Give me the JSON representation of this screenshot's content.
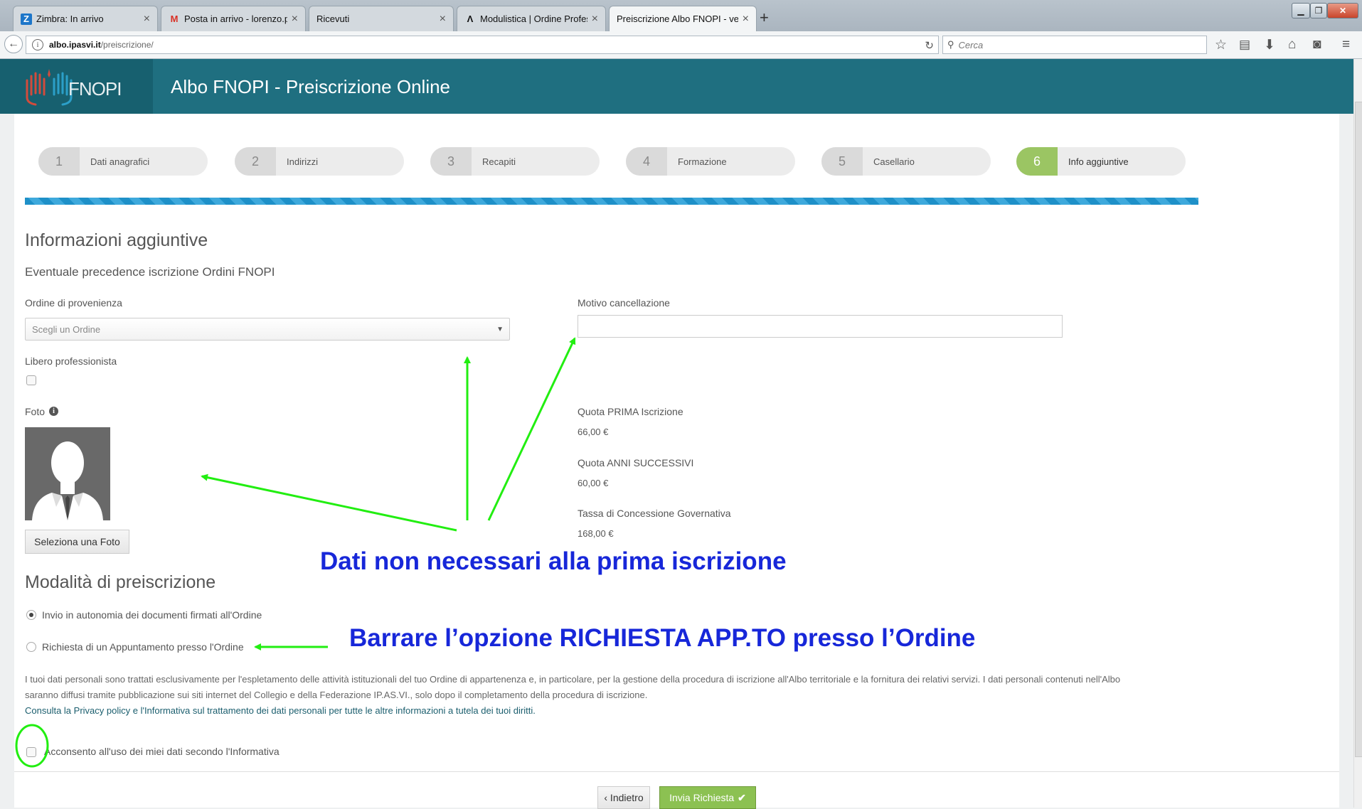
{
  "browser": {
    "tabs": [
      {
        "icon": "Z",
        "title": "Zimbra: In arrivo"
      },
      {
        "icon": "M",
        "title": "Posta in arrivo - lorenzo.pa..."
      },
      {
        "icon": "",
        "title": "Ricevuti"
      },
      {
        "icon": "Λ",
        "title": "Modulistica | Ordine Profes..."
      },
      {
        "icon": "",
        "title": "Preiscrizione Albo FNOPI - ver. ..."
      }
    ],
    "url_host": "albo.ipasvi.it",
    "url_path": "/preiscrizione/",
    "search_placeholder": "Cerca"
  },
  "header": {
    "logo_text": "FNOPI",
    "title": "Albo FNOPI - Preiscrizione Online"
  },
  "steps": [
    {
      "num": "1",
      "label": "Dati anagrafici"
    },
    {
      "num": "2",
      "label": "Indirizzi"
    },
    {
      "num": "3",
      "label": "Recapiti"
    },
    {
      "num": "4",
      "label": "Formazione"
    },
    {
      "num": "5",
      "label": "Casellario"
    },
    {
      "num": "6",
      "label": "Info aggiuntive"
    }
  ],
  "form": {
    "section_title": "Informazioni aggiuntive",
    "subsection": "Eventuale precedence iscrizione Ordini FNOPI",
    "ordine_label": "Ordine di provenienza",
    "ordine_placeholder": "Scegli un Ordine",
    "motivo_label": "Motivo cancellazione",
    "libero_label": "Libero professionista",
    "foto_label": "Foto",
    "foto_button": "Seleziona una Foto",
    "quote": [
      {
        "label": "Quota PRIMA Iscrizione",
        "value": "66,00 €"
      },
      {
        "label": "Quota ANNI SUCCESSIVI",
        "value": "60,00 €"
      },
      {
        "label": "Tassa di Concessione Governativa",
        "value": "168,00 €"
      }
    ],
    "modalita_title": "Modalità di preiscrizione",
    "radio_1": "Invio in autonomia dei documenti firmati all'Ordine",
    "radio_2": "Richiesta di un Appuntamento presso l'Ordine",
    "privacy_text": "I tuoi dati personali sono trattati esclusivamente per l'espletamento delle attività istituzionali del tuo Ordine di appartenenza e, in particolare, per la gestione della procedura di iscrizione all'Albo territoriale e la fornitura dei relativi servizi. I dati personali contenuti nell'Albo saranno diffusi tramite pubblicazione sui siti internet del Collegio e della Federazione IP.AS.VI., solo dopo il completamento della procedura di iscrizione.",
    "privacy_link": "Consulta la Privacy policy e l'Informativa sul trattamento dei dati personali per tutte le altre informazioni a tutela dei tuoi diritti.",
    "consent_label": "Acconsento all'uso dei miei dati secondo l'Informativa",
    "back_button": "‹ Indietro",
    "submit_button": "Invia Richiesta"
  },
  "annotations": {
    "note_1": "Dati non necessari alla prima iscrizione",
    "note_2": "Barrare l’opzione RICHIESTA APP.TO presso l’Ordine",
    "arrow_color": "#22ee11"
  }
}
